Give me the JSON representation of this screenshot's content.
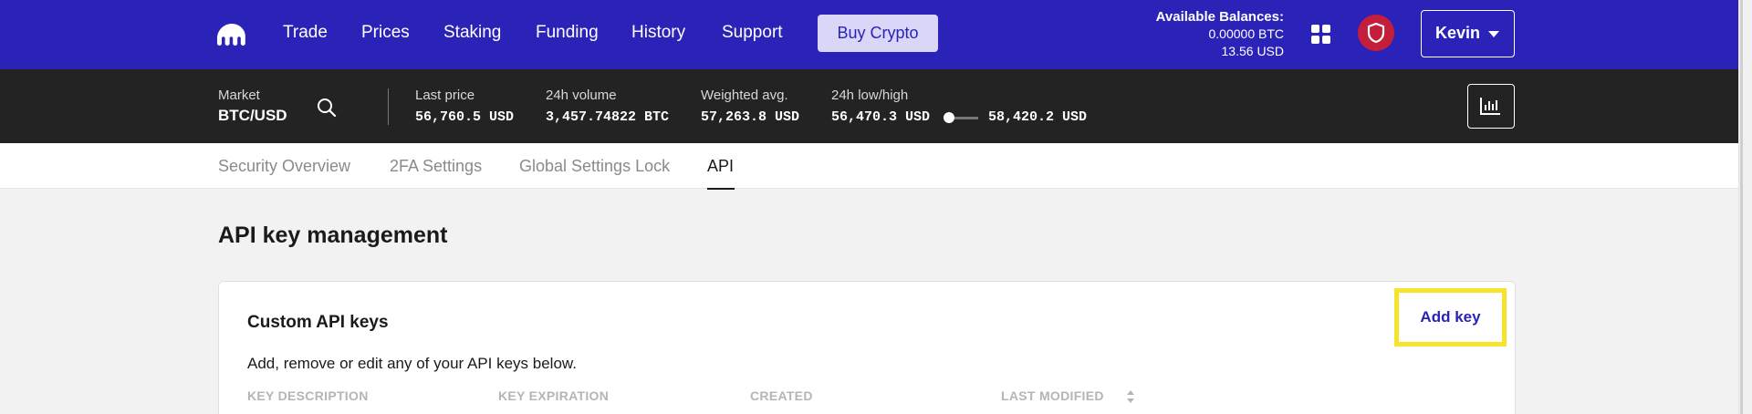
{
  "topnav": {
    "logo": "kraken-logo-icon",
    "items": [
      "Trade",
      "Prices",
      "Staking",
      "Funding",
      "History",
      "Support"
    ],
    "buy_button": "Buy Crypto",
    "balances": {
      "title": "Available Balances:",
      "btc": "0.00000 BTC",
      "usd": "13.56 USD"
    },
    "user_name": "Kevin",
    "colors": {
      "nav_bg": "#2b23b8",
      "shield_bg": "#c41e3a"
    }
  },
  "market": {
    "market_label": "Market",
    "pair": "BTC/USD",
    "last_price": {
      "label": "Last price",
      "value": "56,760.5 USD"
    },
    "volume": {
      "label": "24h volume",
      "value": "3,457.74822 BTC"
    },
    "weighted": {
      "label": "Weighted avg.",
      "value": "57,263.8 USD"
    },
    "lowhigh": {
      "label": "24h low/high",
      "low": "56,470.3 USD",
      "high": "58,420.2 USD"
    }
  },
  "tabs": [
    "Security Overview",
    "2FA Settings",
    "Global Settings Lock",
    "API"
  ],
  "active_tab": "API",
  "main": {
    "title": "API key management",
    "card": {
      "title": "Custom API keys",
      "description": "Add, remove or edit any of your API keys below.",
      "add_key": "Add key",
      "columns": [
        "KEY DESCRIPTION",
        "KEY EXPIRATION",
        "CREATED",
        "LAST MODIFIED"
      ]
    },
    "highlight_color": "#f6e32a"
  }
}
